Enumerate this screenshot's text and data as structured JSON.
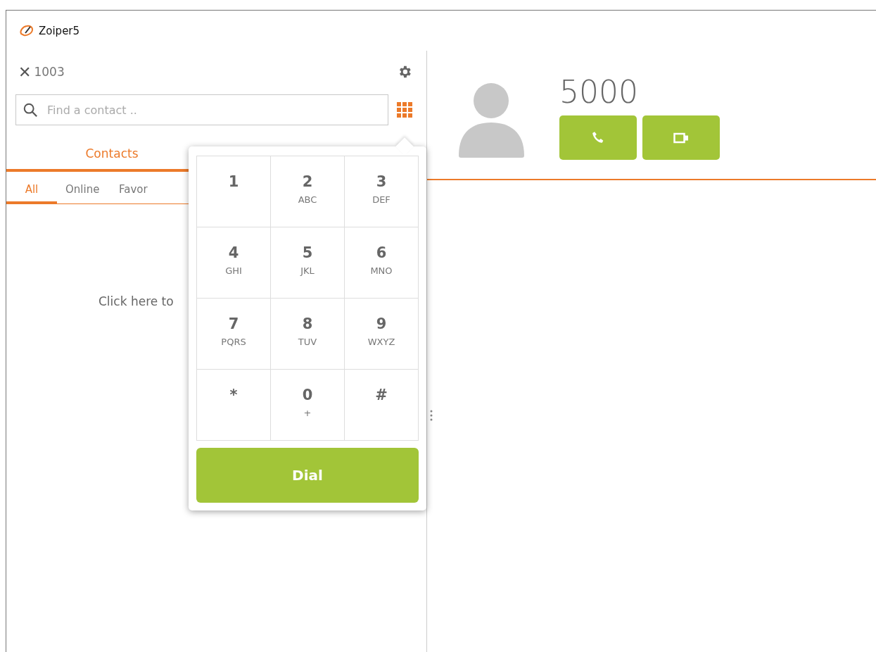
{
  "window": {
    "title": "Zoiper5"
  },
  "account": {
    "close_glyph": "✕",
    "number": "1003"
  },
  "search": {
    "placeholder": "Find a contact .."
  },
  "tabs": [
    {
      "label": "Contacts",
      "selected": true
    }
  ],
  "filters": [
    {
      "label": "All",
      "selected": true
    },
    {
      "label": "Online",
      "selected": false
    },
    {
      "label": "Favor",
      "selected": false
    }
  ],
  "empty_message": "Click here to",
  "dialpad": {
    "keys": [
      {
        "digit": "1"
      },
      {
        "digit": "2",
        "letters": "ABC"
      },
      {
        "digit": "3",
        "letters": "DEF"
      },
      {
        "digit": "4",
        "letters": "GHI"
      },
      {
        "digit": "5",
        "letters": "JKL"
      },
      {
        "digit": "6",
        "letters": "MNO"
      },
      {
        "digit": "7",
        "letters": "PQRS"
      },
      {
        "digit": "8",
        "letters": "TUV"
      },
      {
        "digit": "9",
        "letters": "WXYZ"
      },
      {
        "digit": "*"
      },
      {
        "digit": "0",
        "letters": "+"
      },
      {
        "digit": "#"
      }
    ],
    "dial_button": "Dial"
  },
  "contact": {
    "name": "5000"
  }
}
